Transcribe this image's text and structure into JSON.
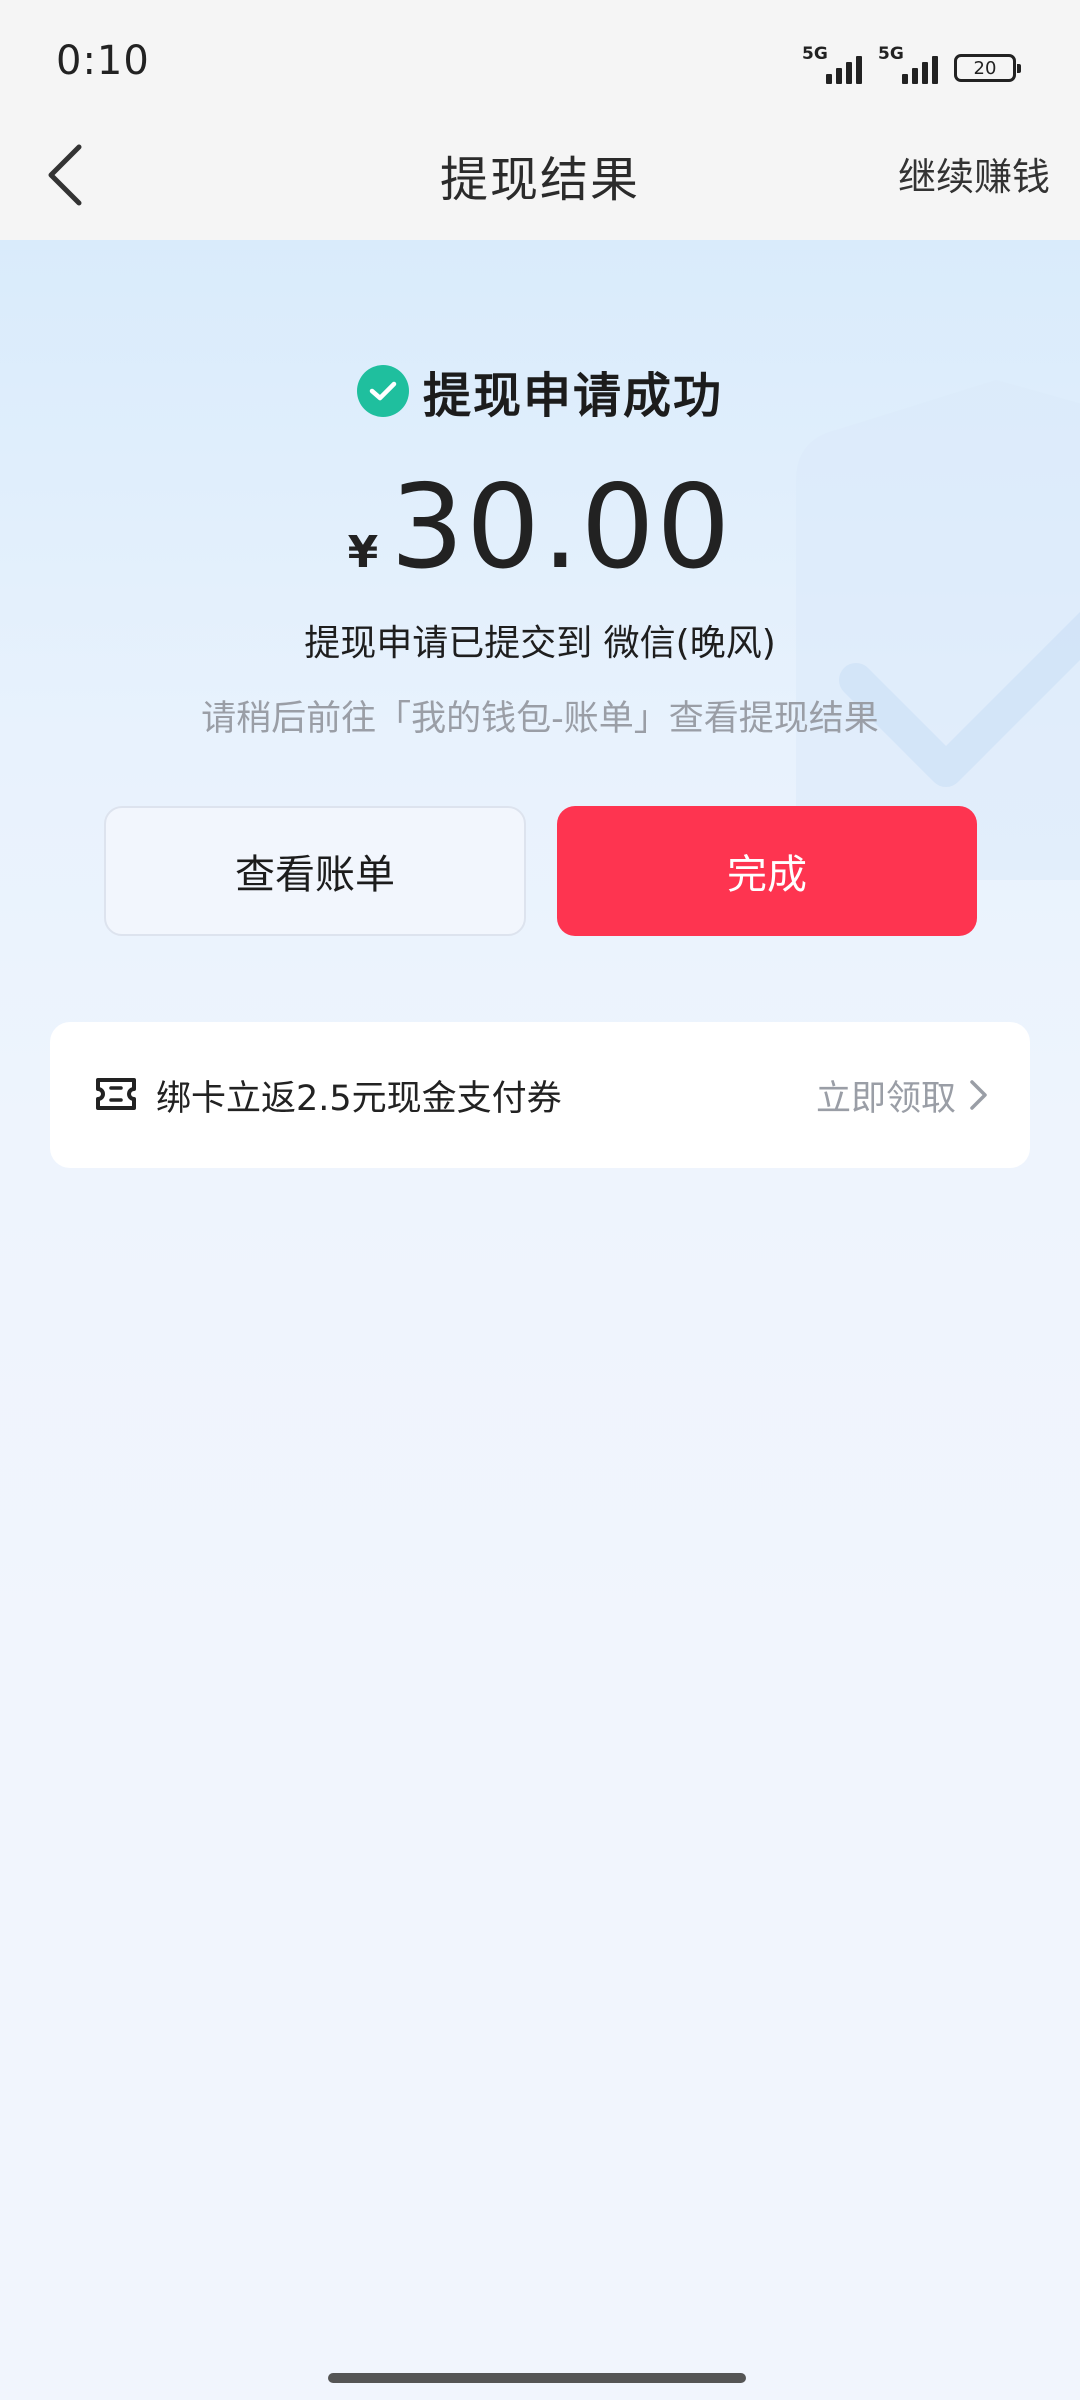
{
  "status_bar": {
    "time": "0:10",
    "network_1": "5G",
    "network_2": "5G",
    "battery": "20"
  },
  "nav": {
    "title": "提现结果",
    "action_label": "继续赚钱"
  },
  "result": {
    "title": "提现申请成功",
    "currency_symbol": "¥",
    "amount": "30.00",
    "submit_note": "提现申请已提交到 微信(晚风)",
    "hint_note": "请稍后前往「我的钱包-账单」查看提现结果"
  },
  "buttons": {
    "view_bill_label": "查看账单",
    "done_label": "完成"
  },
  "coupon": {
    "text": "绑卡立返2.5元现金支付券",
    "action_label": "立即领取"
  },
  "colors": {
    "accent_red": "#fe3450",
    "success_green": "#1fbf9e"
  }
}
